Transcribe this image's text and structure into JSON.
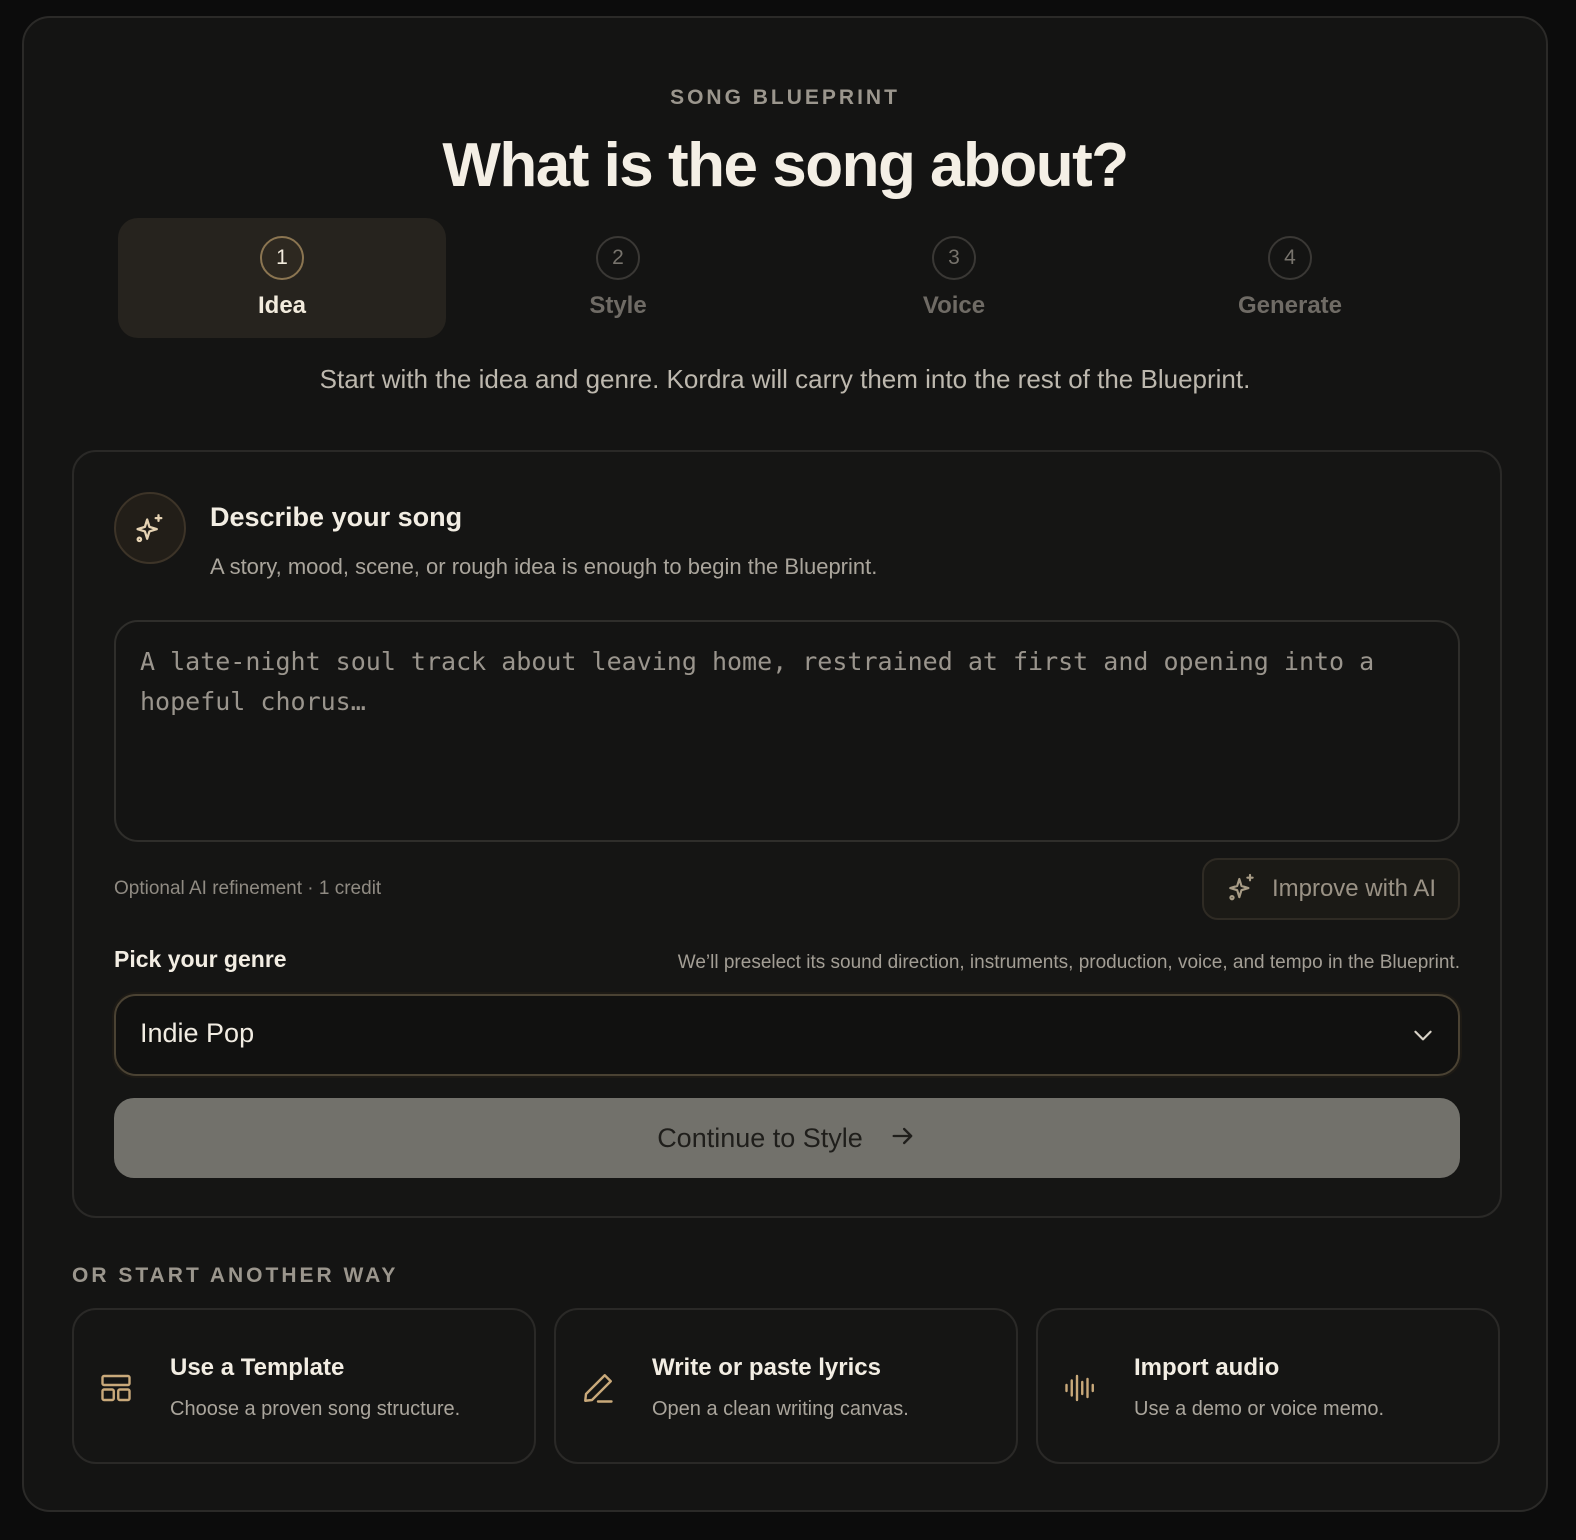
{
  "header": {
    "eyebrow": "SONG BLUEPRINT",
    "title": "What is the song about?"
  },
  "steps": [
    {
      "number": "1",
      "label": "Idea",
      "active": true
    },
    {
      "number": "2",
      "label": "Style",
      "active": false
    },
    {
      "number": "3",
      "label": "Voice",
      "active": false
    },
    {
      "number": "4",
      "label": "Generate",
      "active": false
    }
  ],
  "intro": "Start with the idea and genre. Kordra will carry them into the rest of the Blueprint.",
  "describe": {
    "icon": "sparkles-icon",
    "title": "Describe your song",
    "subtitle": "A story, mood, scene, or rough idea is enough to begin the Blueprint.",
    "placeholder": "A late-night soul track about leaving home, restrained at first and opening into a hopeful chorus…",
    "value": "",
    "ai_note": "Optional AI refinement · 1 credit",
    "improve_label": "Improve with AI"
  },
  "genre": {
    "label": "Pick your genre",
    "hint": "We’ll preselect its sound direction, instruments, production, voice, and tempo in the Blueprint.",
    "selected": "Indie Pop"
  },
  "continue_label": "Continue to Style",
  "alternatives": {
    "heading": "OR START ANOTHER WAY",
    "items": [
      {
        "icon": "template-layout-icon",
        "title": "Use a Template",
        "desc": "Choose a proven song structure."
      },
      {
        "icon": "pencil-icon",
        "title": "Write or paste lyrics",
        "desc": "Open a clean writing canvas."
      },
      {
        "icon": "audio-waveform-icon",
        "title": "Import audio",
        "desc": "Use a demo or voice memo."
      }
    ]
  },
  "colors": {
    "background": "#141413",
    "accent": "#c9a97a",
    "active_step_bg": "#26231e",
    "button_gray": "#72716b"
  }
}
